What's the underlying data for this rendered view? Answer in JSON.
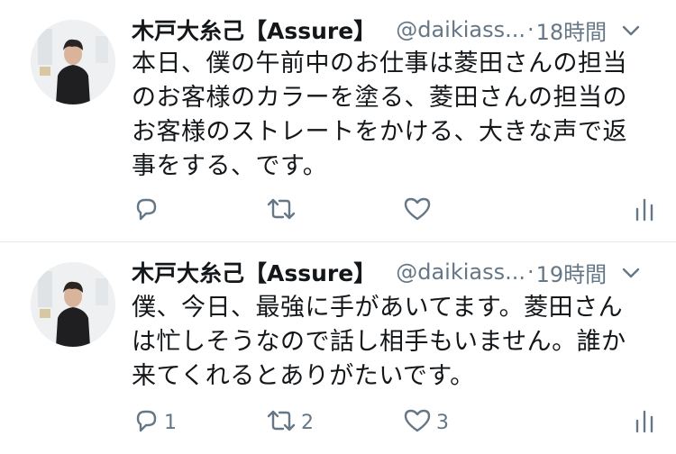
{
  "tweets": [
    {
      "name": "木戸大糸己【Assure】",
      "handle": "@daikiass...",
      "separator": "·",
      "time": "18時間",
      "text": "本日、僕の午前中のお仕事は菱田さんの担当\nのお客様のカラーを塗る、菱田さんの担当の\nお客様のストレートをかける、大きな声で返\n事をする、です。",
      "reply_count": "",
      "retweet_count": "",
      "like_count": ""
    },
    {
      "name": "木戸大糸己【Assure】",
      "handle": "@daikiass...",
      "separator": "·",
      "time": "19時間",
      "text": "僕、今日、最強に手があいてます。菱田さん\nは忙しそうなので話し相手もいません。誰か\n来てくれるとありがたいです。",
      "reply_count": "1",
      "retweet_count": "2",
      "like_count": "3"
    }
  ],
  "colors": {
    "text": "#14171a",
    "secondary": "#657786",
    "divider": "#e1e8ed"
  },
  "icons": [
    "reply-icon",
    "retweet-icon",
    "like-icon",
    "analytics-icon",
    "chevron-down-icon"
  ]
}
